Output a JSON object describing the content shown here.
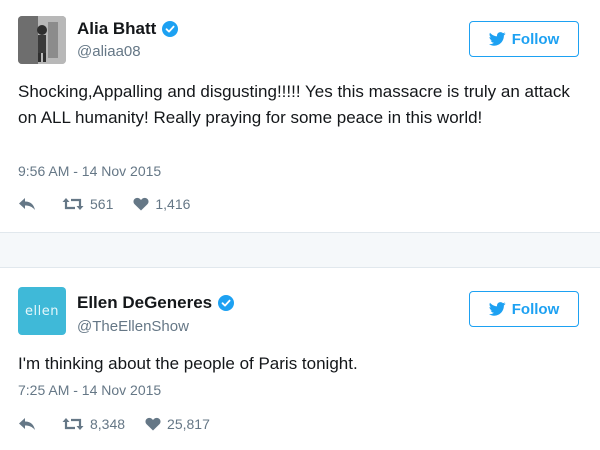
{
  "tweets": [
    {
      "name": "Alia Bhatt",
      "handle": "@aliaa08",
      "follow_label": "Follow",
      "text": "Shocking,Appalling and disgusting!!!!! Yes this massacre is truly an attack on ALL humanity! Really praying for some peace in this world!",
      "timestamp": "9:56 AM - 14 Nov 2015",
      "retweets": "561",
      "likes": "1,416",
      "avatar_icon": "profile-photo"
    },
    {
      "name": "Ellen DeGeneres",
      "handle": "@TheEllenShow",
      "follow_label": "Follow",
      "text": "I'm thinking about the people of Paris tonight.",
      "timestamp": "7:25 AM - 14 Nov 2015",
      "retweets": "8,348",
      "likes": "25,817",
      "avatar_text": "ellen"
    }
  ],
  "colors": {
    "accent": "#1da1f2",
    "muted": "#657786",
    "text": "#14171a",
    "ellen_avatar": "#3fb9d8"
  },
  "icons": {
    "verified": "verified-badge-icon",
    "bird": "twitter-bird-icon",
    "reply": "reply-icon",
    "retweet": "retweet-icon",
    "like": "heart-icon"
  }
}
